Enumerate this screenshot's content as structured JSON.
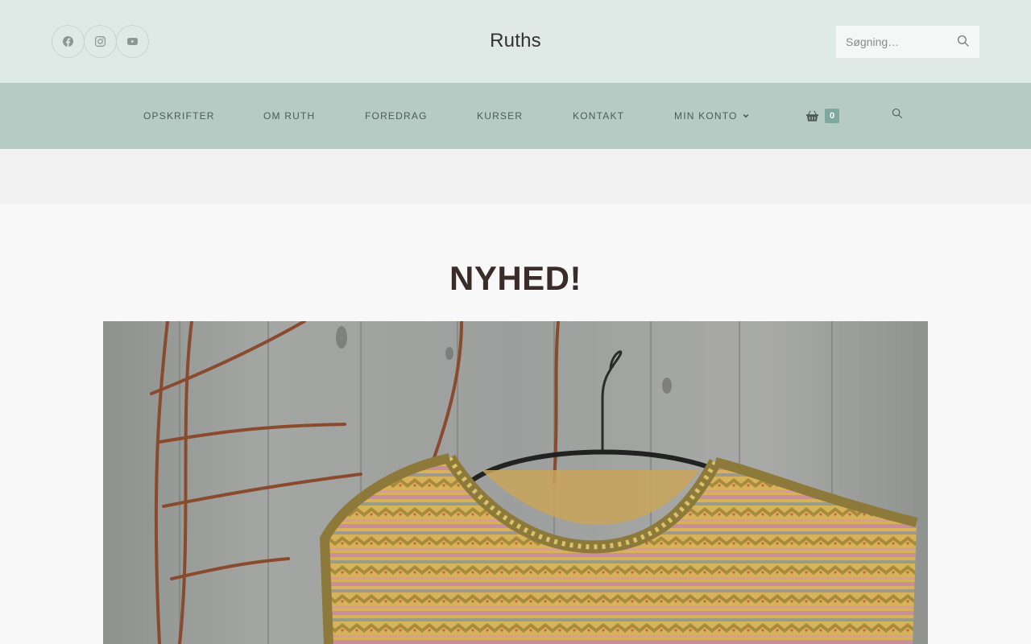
{
  "header": {
    "site_title": "Ruths",
    "social": [
      {
        "icon": "facebook-icon"
      },
      {
        "icon": "instagram-icon"
      },
      {
        "icon": "youtube-icon"
      }
    ],
    "search_placeholder": "Søgning…"
  },
  "nav": {
    "items": [
      "OPSKRIFTER",
      "OM RUTH",
      "FOREDRAG",
      "KURSER",
      "KONTAKT",
      "MIN KONTO"
    ],
    "cart_count": "0"
  },
  "post": {
    "title": "NYHED!"
  },
  "colors": {
    "topbar": "#dfe9e5",
    "navbar": "#b5cbc4",
    "cart_badge": "#7fa89c",
    "title": "#3a2c29"
  }
}
